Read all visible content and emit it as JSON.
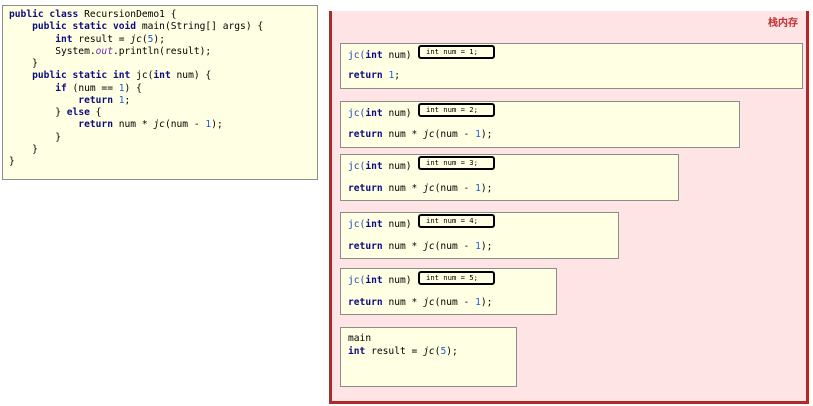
{
  "code": {
    "l1_a": "public class ",
    "l1_b": "RecursionDemo1 {",
    "l2_a": "    public static void ",
    "l2_b": "main(String[] args) {",
    "l3_a": "        int ",
    "l3_b": "result = ",
    "l3_c": "jc",
    "l3_d": "(",
    "l3_e": "5",
    "l3_f": ");",
    "l4_a": "        System.",
    "l4_b": "out",
    "l4_c": ".println(result);",
    "l5": "    }",
    "l6_a": "    public static int ",
    "l6_b": "jc(",
    "l6_c": "int ",
    "l6_d": "num) {",
    "l7_a": "        if ",
    "l7_b": "(num == ",
    "l7_c": "1",
    "l7_d": ") {",
    "l8_a": "            return ",
    "l8_b": "1",
    "l8_c": ";",
    "l9_a": "        } ",
    "l9_b": "else ",
    "l9_c": "{",
    "l10_a": "            return ",
    "l10_b": "num * ",
    "l10_c": "jc",
    "l10_d": "(num - ",
    "l10_e": "1",
    "l10_f": ");",
    "l11": "        }",
    "l12": "    }",
    "l13": "}"
  },
  "stack": {
    "title": "栈内存",
    "sig_a": "jc(",
    "sig_b": "int ",
    "sig_c": "num)",
    "frames": [
      {
        "param": "int num = 1;",
        "ret_kw": "return ",
        "ret_num": "1",
        "ret_end": ";"
      },
      {
        "param": "int num = 2;",
        "ret_kw": "return ",
        "ret_a": "num * ",
        "ret_fn": "jc",
        "ret_b": "(num - ",
        "ret_num": "1",
        "ret_end": ");"
      },
      {
        "param": "int num = 3;",
        "ret_kw": "return ",
        "ret_a": "num * ",
        "ret_fn": "jc",
        "ret_b": "(num - ",
        "ret_num": "1",
        "ret_end": ");"
      },
      {
        "param": "int num = 4;",
        "ret_kw": "return ",
        "ret_a": "num * ",
        "ret_fn": "jc",
        "ret_b": "(num - ",
        "ret_num": "1",
        "ret_end": ");"
      },
      {
        "param": "int num = 5;",
        "ret_kw": "return ",
        "ret_a": "num * ",
        "ret_fn": "jc",
        "ret_b": "(num - ",
        "ret_num": "1",
        "ret_end": ");"
      }
    ],
    "main": {
      "label": "main",
      "line_a": "int ",
      "line_b": "result = ",
      "line_c": "jc",
      "line_d": "(",
      "line_e": "5",
      "line_f": ");"
    }
  },
  "colors": {
    "keyword": "#0d0d80",
    "number": "#1f5bd6",
    "stack_bg": "#ffe4e6",
    "stack_border": "#b02a2a",
    "frame_bg": "#ffffe3"
  }
}
